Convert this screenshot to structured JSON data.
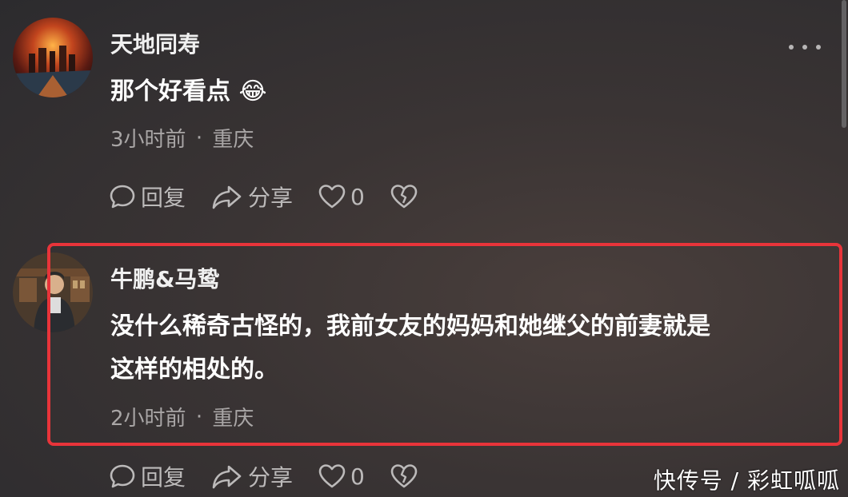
{
  "comments": [
    {
      "username": "天地同寿",
      "text": "那个好看点",
      "emoji": "😂",
      "time": "3小时前",
      "location": "重庆",
      "reply_label": "回复",
      "share_label": "分享",
      "like_count": "0"
    },
    {
      "username": "牛鹏&马鸷",
      "text_line1": "没什么稀奇古怪的，我前女友的妈妈和她继父的前妻就是",
      "text_line2": "这样的相处的。",
      "time": "2小时前",
      "location": "重庆",
      "reply_label": "回复",
      "share_label": "分享",
      "like_count": "0"
    }
  ],
  "meta_separator": "·",
  "watermark": "快传号 / 彩虹呱呱",
  "colors": {
    "highlight": "#e8343a",
    "meta": "#a9a6a6"
  }
}
